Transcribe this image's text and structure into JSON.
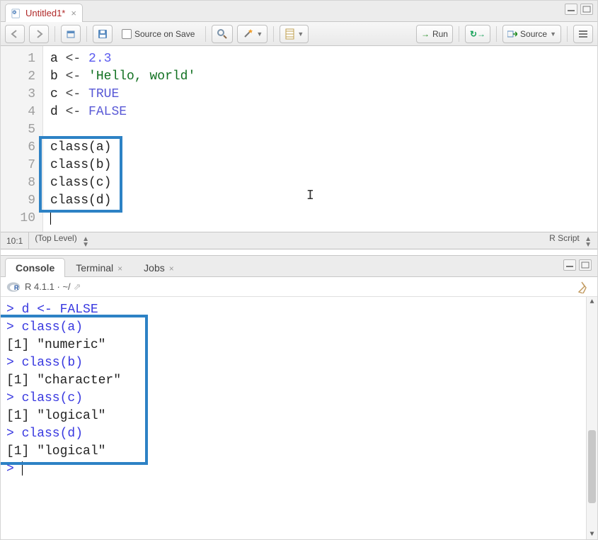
{
  "tab": {
    "title": "Untitled1*",
    "close": "×"
  },
  "toolbar": {
    "source_on_save": "Source on Save",
    "run": "Run",
    "source": "Source"
  },
  "editor": {
    "lines": [
      "1",
      "2",
      "3",
      "4",
      "5",
      "6",
      "7",
      "8",
      "9",
      "10"
    ],
    "l1": {
      "ident": "a",
      "assign": "<-",
      "num": "2.3"
    },
    "l2": {
      "ident": "b",
      "assign": "<-",
      "str": "'Hello, world'"
    },
    "l3": {
      "ident": "c",
      "assign": "<-",
      "const": "TRUE"
    },
    "l4": {
      "ident": "d",
      "assign": "<-",
      "const": "FALSE"
    },
    "l6": "class(a)",
    "l7": "class(b)",
    "l8": "class(c)",
    "l9": "class(d)"
  },
  "status": {
    "pos": "10:1",
    "scope": "(Top Level)",
    "lang": "R Script"
  },
  "console_tabs": {
    "console": "Console",
    "terminal": "Terminal",
    "jobs": "Jobs"
  },
  "console_info": {
    "version": "R 4.1.1 · ~/"
  },
  "console": {
    "l0": "> d <- FALSE",
    "l1": "> class(a)",
    "l2": "[1] \"numeric\"",
    "l3": "> class(b)",
    "l4": "[1] \"character\"",
    "l5": "> class(c)",
    "l6": "[1] \"logical\"",
    "l7": "> class(d)",
    "l8": "[1] \"logical\"",
    "l9": "> "
  }
}
